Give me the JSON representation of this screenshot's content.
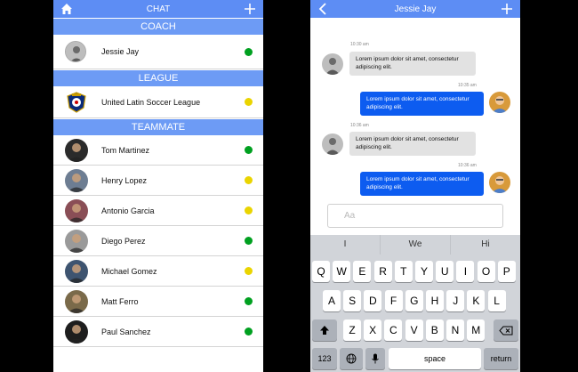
{
  "left": {
    "title": "CHAT",
    "sections": {
      "coach": "COACH",
      "league": "LEAGUE",
      "teammate": "TEAMMATE"
    },
    "coach": {
      "name": "Jessie Jay",
      "status": "#00a020"
    },
    "league": {
      "name": "United Latin Soccer League",
      "status": "#ead400"
    },
    "teammates": [
      {
        "name": "Tom Martinez",
        "status": "#00a020"
      },
      {
        "name": "Henry Lopez",
        "status": "#ead400"
      },
      {
        "name": "Antonio Garcia",
        "status": "#ead400"
      },
      {
        "name": "Diego Perez",
        "status": "#00a020"
      },
      {
        "name": "Michael Gomez",
        "status": "#ead400"
      },
      {
        "name": "Matt Ferro",
        "status": "#00a020"
      },
      {
        "name": "Paul Sanchez",
        "status": "#00a020"
      }
    ]
  },
  "right": {
    "title": "Jessie Jay",
    "messages": [
      {
        "time": "10:30 am",
        "text": "Lorem ipsum dolor sit amet, consectetur adipiscing elit.",
        "dir": "in"
      },
      {
        "time": "10:35 am",
        "text": "Lorem ipsum dolor sit amet, consectetur adipiscing elit.",
        "dir": "out"
      },
      {
        "time": "10:36 am",
        "text": "Lorem ipsum dolor sit amet, consectetur adipiscing elit.",
        "dir": "in"
      },
      {
        "time": "10:36 am",
        "text": "Lorem ipsum dolor sit amet, consectetur adipiscing elit.",
        "dir": "out"
      }
    ],
    "composer_placeholder": "Aa",
    "suggestions": [
      "I",
      "We",
      "Hi"
    ],
    "keyboard": {
      "row1": [
        "Q",
        "W",
        "E",
        "R",
        "T",
        "Y",
        "U",
        "I",
        "O",
        "P"
      ],
      "row2": [
        "A",
        "S",
        "D",
        "F",
        "G",
        "H",
        "J",
        "K",
        "L"
      ],
      "row3": [
        "Z",
        "X",
        "C",
        "V",
        "B",
        "N",
        "M"
      ],
      "numbers": "123",
      "space": "space",
      "return": "return"
    }
  },
  "colors": {
    "header": "#5d8df4",
    "section": "#6d9bf5",
    "online": "#00a020",
    "away": "#ead400",
    "outgoing_bubble": "#0d5cf0"
  }
}
